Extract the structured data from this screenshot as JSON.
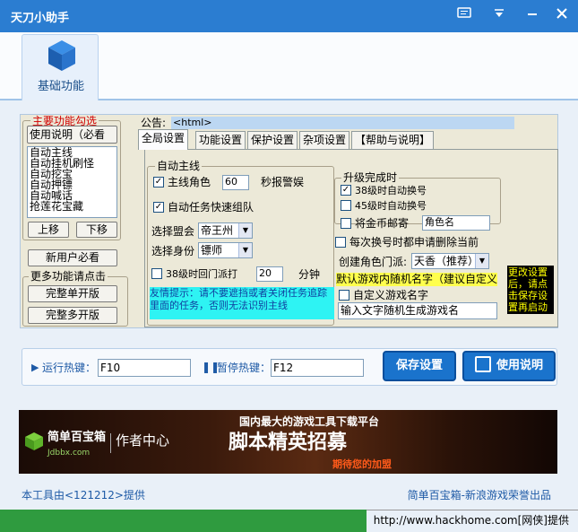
{
  "window": {
    "title": "天刀小助手"
  },
  "toolbar": {
    "basic_label": "基础功能"
  },
  "left": {
    "main_group_title": "主要功能勾选",
    "usage_button": "使用说明（必看",
    "features": [
      "自动主线",
      "自动挂机刷怪",
      "自动挖宝",
      "自动押镖",
      "自动喊话",
      "抢莲花宝藏"
    ],
    "up_button": "上移",
    "down_button": "下移",
    "newuser_button": "新用户必看",
    "more_group_title": "更多功能请点击",
    "single_button": "完整单开版",
    "multi_button": "完整多开版"
  },
  "notice": {
    "label": "公告:",
    "value": "<html>"
  },
  "tabs": [
    "全局设置",
    "功能设置",
    "保护设置",
    "杂项设置",
    "【帮助与说明】"
  ],
  "main_line": {
    "group_title": "自动主线",
    "role_label": "主线角色",
    "role_value": "60",
    "alarm_label": "秒报警娱",
    "team_label": "自动任务快速组队",
    "alliance_label": "选择盟会",
    "alliance_value": "帝王州",
    "identity_label": "选择身份",
    "identity_value": "镖师",
    "return_label": "38级时回门派打",
    "return_value": "20",
    "return_unit": "分钟",
    "tip": "友情提示：请不要遮挡或者关闭任务追踪里面的任务，否则无法识别主线"
  },
  "upgrade": {
    "group_title": "升级完成时",
    "opt38": "38级时自动换号",
    "opt45": "45级时自动换号",
    "mail_label": "将金币邮寄",
    "mail_value": "角色名",
    "delete_label": "每次换号时都申请删除当前",
    "sect_label": "创建角色门派:",
    "sect_value": "天香（推荐）",
    "default_name": "默认游戏内随机名字（建议自定义",
    "custom_label": "自定义游戏名字",
    "custom_value": "输入文字随机生成游戏名"
  },
  "side_note": "更改设置后，请点击保存设置再启动",
  "hotkeys": {
    "run_label": "运行热键：",
    "run_value": "F10",
    "pause_label": "暂停热键：",
    "pause_value": "F12",
    "save_button": "保存设置",
    "help_button": "使用说明"
  },
  "banner": {
    "brand": "简单百宝箱",
    "brand_url": "Jdbbx.com",
    "author": "作者中心",
    "headline_small": "国内最大的游戏工具下载平台",
    "headline": "脚本精英招募",
    "sub": "期待您的加盟"
  },
  "footer": {
    "left": "本工具由<121212>提供",
    "right": "简单百宝箱-新浪游戏荣誉出品"
  },
  "statusbar": {
    "text": "http://www.hackhome.com[网侠]提供"
  },
  "colors": {
    "title_bar": "#2b7dd1",
    "accent_button": "#1a73cc",
    "tip_bg": "#2ef3f3",
    "default_name_bg": "#ffff4d",
    "side_note_bg": "#000000",
    "side_note_fg": "#ffff00",
    "status_green": "#2f9b3f"
  }
}
